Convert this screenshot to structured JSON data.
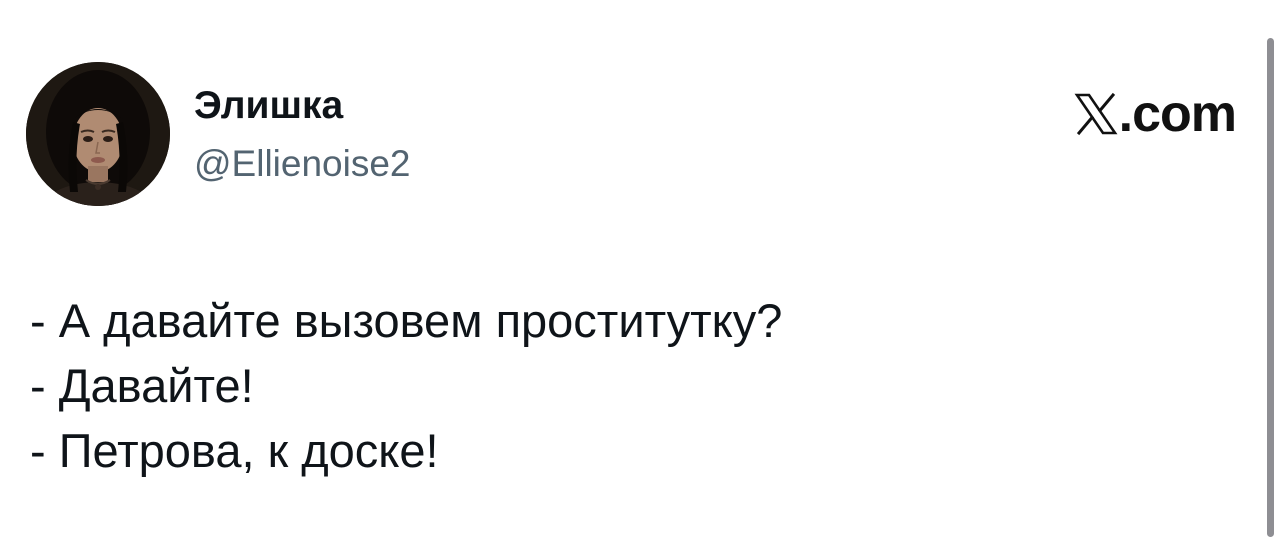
{
  "author": {
    "display_name": "Элишка",
    "handle": "@Ellienoise2",
    "avatar_icon": "user-avatar-photo"
  },
  "brand": {
    "logo_icon": "x-logo-icon",
    "suffix": ".com"
  },
  "tweet": {
    "lines": [
      "- А давайте вызовем проститутку?",
      "- Давайте!",
      "- Петрова, к доске!"
    ]
  },
  "colors": {
    "text_primary": "#0f1419",
    "text_secondary": "#536471",
    "background": "#ffffff",
    "scrollbar": "#8e8e93"
  }
}
